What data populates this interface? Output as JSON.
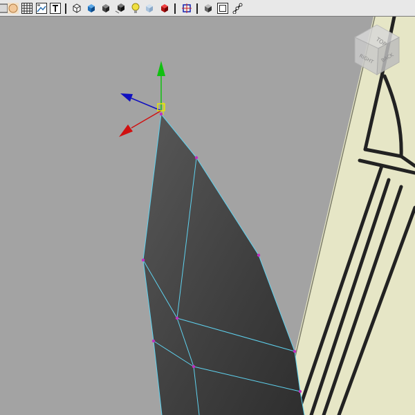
{
  "toolbar": {
    "icons": [
      {
        "name": "snap-toggle-icon"
      },
      {
        "name": "shading-sphere-icon"
      },
      {
        "name": "wireframe-grid-icon"
      },
      {
        "name": "image-plane-icon"
      },
      {
        "name": "texture-text-icon"
      },
      {
        "name": "wireframe-cube-icon"
      },
      {
        "name": "smooth-shade-cube-icon"
      },
      {
        "name": "flat-shade-cube-icon"
      },
      {
        "name": "shadow-cube-icon"
      },
      {
        "name": "light-bulb-icon"
      },
      {
        "name": "xray-cube-icon"
      },
      {
        "name": "red-cube-icon"
      },
      {
        "name": "isolate-select-icon"
      },
      {
        "name": "xray-joint-icon"
      },
      {
        "name": "resolution-gate-icon"
      },
      {
        "name": "joint-tool-icon"
      }
    ]
  },
  "viewcube": {
    "top_label": "TOP",
    "right_label": "RIGHT",
    "back_label": "BACK"
  },
  "colors": {
    "viewport_bg": "#a3a3a3",
    "mesh_face": "#454545",
    "wire_selected": "#5fd3f0",
    "vertex": "#c030c0",
    "ground_plane": "#e6e6c6",
    "axis_x": "#d01010",
    "axis_y": "#10c010",
    "axis_z": "#1010c0"
  }
}
